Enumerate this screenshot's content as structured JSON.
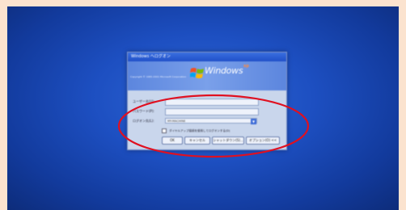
{
  "dialog": {
    "title": "Windows へログオン",
    "brand": "Windows",
    "edition": "xp",
    "copyright": "Copyright © 1985-2001 Microsoft Corporation"
  },
  "form": {
    "username_label": "ユーザー名(U):",
    "password_label": "パスワード(P):",
    "domain_label": "ログオン先(L):",
    "domain_value": "MY-MACHINE",
    "remember_label": "ダイヤルアップ接続を使用してログオンする(D)"
  },
  "buttons": {
    "ok": "OK",
    "cancel": "キャンセル",
    "shutdown": "シャットダウン(S)...",
    "options": "オプション(O) <<"
  },
  "annotation": {
    "color": "#e01020"
  }
}
